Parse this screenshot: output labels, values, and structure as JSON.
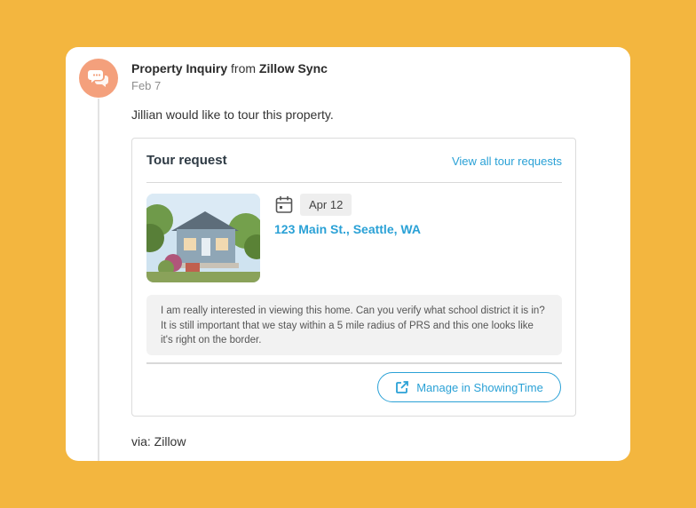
{
  "header": {
    "title": "Property Inquiry",
    "from_word": "from",
    "source": "Zillow Sync",
    "date": "Feb 7"
  },
  "message": "Jillian would like to tour this property.",
  "tour": {
    "title": "Tour request",
    "view_all_label": "View all tour requests",
    "date": "Apr 12",
    "address": "123 Main St., Seattle, WA",
    "note": "I am really interested in viewing this home. Can you verify what school district it is in? It is still important that we stay within a 5 mile radius of PRS and this one looks like it's right on the border.",
    "manage_label": "Manage in ShowingTime"
  },
  "via": "via: Zillow",
  "icons": {
    "avatar": "chat-bubbles-icon",
    "calendar": "calendar-icon",
    "external": "external-link-icon"
  },
  "colors": {
    "background": "#F3B63F",
    "avatar": "#F4A07C",
    "link": "#2AA1D6"
  }
}
